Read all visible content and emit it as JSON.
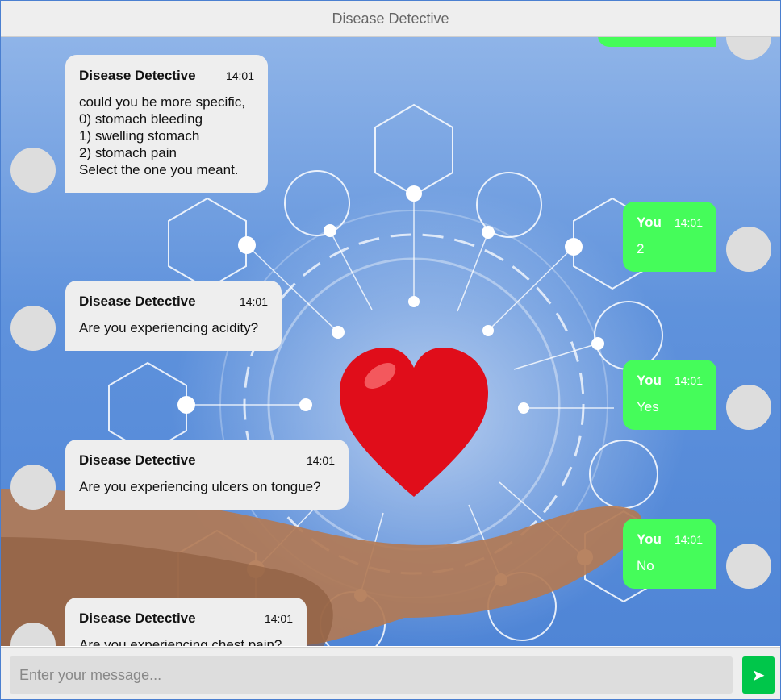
{
  "app": {
    "title": "Disease Detective"
  },
  "messages": [
    {
      "sender": "bot",
      "name": "Disease Detective",
      "time": "14:01",
      "text": "could you be more specific,\n0) stomach bleeding\n1) swelling stomach\n2) stomach pain\nSelect the one you meant."
    },
    {
      "sender": "user",
      "name": "You",
      "time": "14:01",
      "text": "2"
    },
    {
      "sender": "bot",
      "name": "Disease Detective",
      "time": "14:01",
      "text": "Are you experiencing acidity?"
    },
    {
      "sender": "user",
      "name": "You",
      "time": "14:01",
      "text": "Yes"
    },
    {
      "sender": "bot",
      "name": "Disease Detective",
      "time": "14:01",
      "text": "Are you experiencing ulcers on tongue?"
    },
    {
      "sender": "user",
      "name": "You",
      "time": "14:01",
      "text": "No"
    },
    {
      "sender": "bot",
      "name": "Disease Detective",
      "time": "14:01",
      "text": "Are you experiencing chest pain?"
    }
  ],
  "input": {
    "placeholder": "Enter your message..."
  },
  "send": {
    "icon": "send-arrow-icon",
    "glyph": "➤"
  },
  "colors": {
    "user_bubble": "#45fc5a",
    "bot_bubble": "#eeeeee",
    "send_button": "#00c64a",
    "header": "#eeeeee"
  }
}
